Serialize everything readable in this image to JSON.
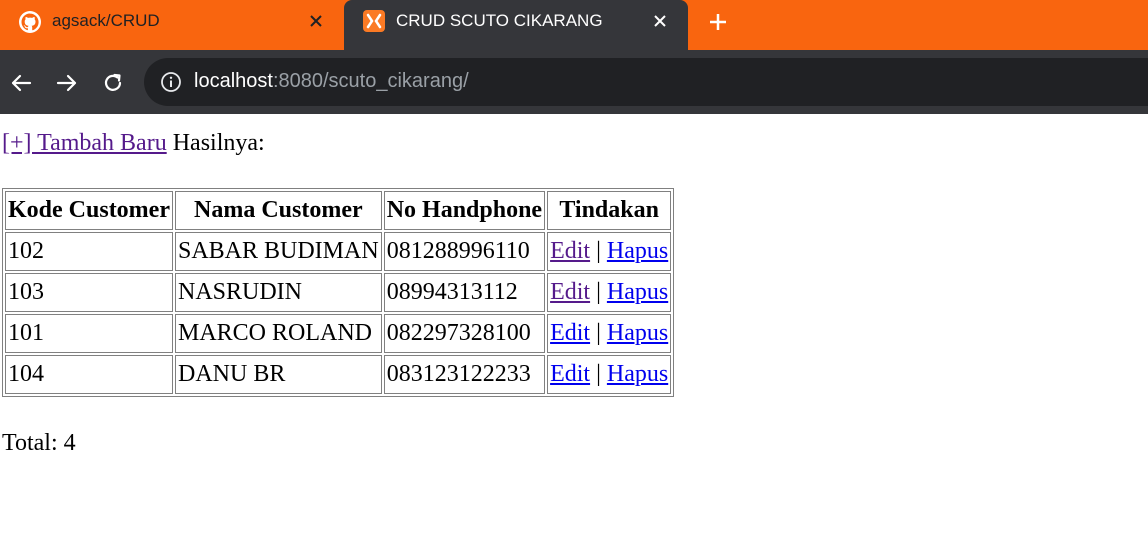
{
  "browser": {
    "tabs": [
      {
        "title": "agsack/CRUD",
        "favicon": "github-icon",
        "active": false
      },
      {
        "title": "CRUD SCUTO CIKARANG",
        "favicon": "xampp-icon",
        "active": true
      }
    ],
    "url_host": "localhost",
    "url_rest": ":8080/scuto_cikarang/",
    "colors": {
      "tabstrip": "#f9650f",
      "toolbar": "#35363a",
      "omnibox": "#202124"
    }
  },
  "page": {
    "add_link": "[+] Tambah Baru",
    "result_label": " Hasilnya:",
    "table": {
      "headers": [
        "Kode Customer",
        "Nama Customer",
        "No Handphone",
        "Tindakan"
      ],
      "rows": [
        {
          "kode": "102",
          "nama": "SABAR BUDIMAN",
          "hp": "081288996110"
        },
        {
          "kode": "103",
          "nama": "NASRUDIN",
          "hp": "08994313112"
        },
        {
          "kode": "101",
          "nama": "MARCO ROLAND",
          "hp": "082297328100"
        },
        {
          "kode": "104",
          "nama": "DANU BR",
          "hp": "083123122233"
        }
      ],
      "edit_label": "Edit",
      "delete_label": "Hapus",
      "separator": "|"
    },
    "total": "Total: 4"
  }
}
